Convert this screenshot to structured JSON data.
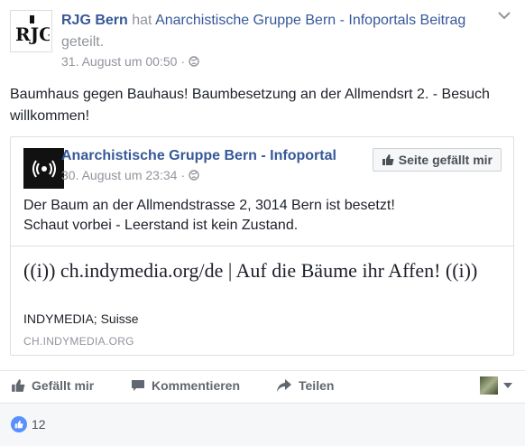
{
  "header": {
    "author": "RJG Bern",
    "verb": "hat",
    "target_page": "Anarchistische Gruppe Bern - Infoportals",
    "object": "Beitrag",
    "action": "geteilt.",
    "timestamp": "31. August um 00:50",
    "separator": "·",
    "avatar_text": "RJG"
  },
  "post": {
    "text": "Baumhaus gegen Bauhaus! Baumbesetzung an der Allmendsrt 2. - Besuch willkommen!"
  },
  "shared": {
    "page_name": "Anarchistische Gruppe Bern - Infoportal",
    "timestamp": "30. August um 23:34",
    "separator": "·",
    "like_button": "Seite gefällt mir",
    "text_line1": "Der Baum an der Allmendstrasse 2, 3014 Bern ist besetzt!",
    "text_line2": "Schaut vorbei - Leerstand ist kein Zustand.",
    "link": {
      "title": "((i)) ch.indymedia.org/de | Auf die Bäume ihr Affen! ((i))",
      "description": "INDYMEDIA; Suisse",
      "domain": "CH.INDYMEDIA.ORG"
    }
  },
  "actions": {
    "like": "Gefällt mir",
    "comment": "Kommentieren",
    "share": "Teilen"
  },
  "footer": {
    "like_count": "12"
  },
  "colors": {
    "link": "#365899",
    "meta": "#90949c",
    "like_blue": "#5890ff"
  }
}
